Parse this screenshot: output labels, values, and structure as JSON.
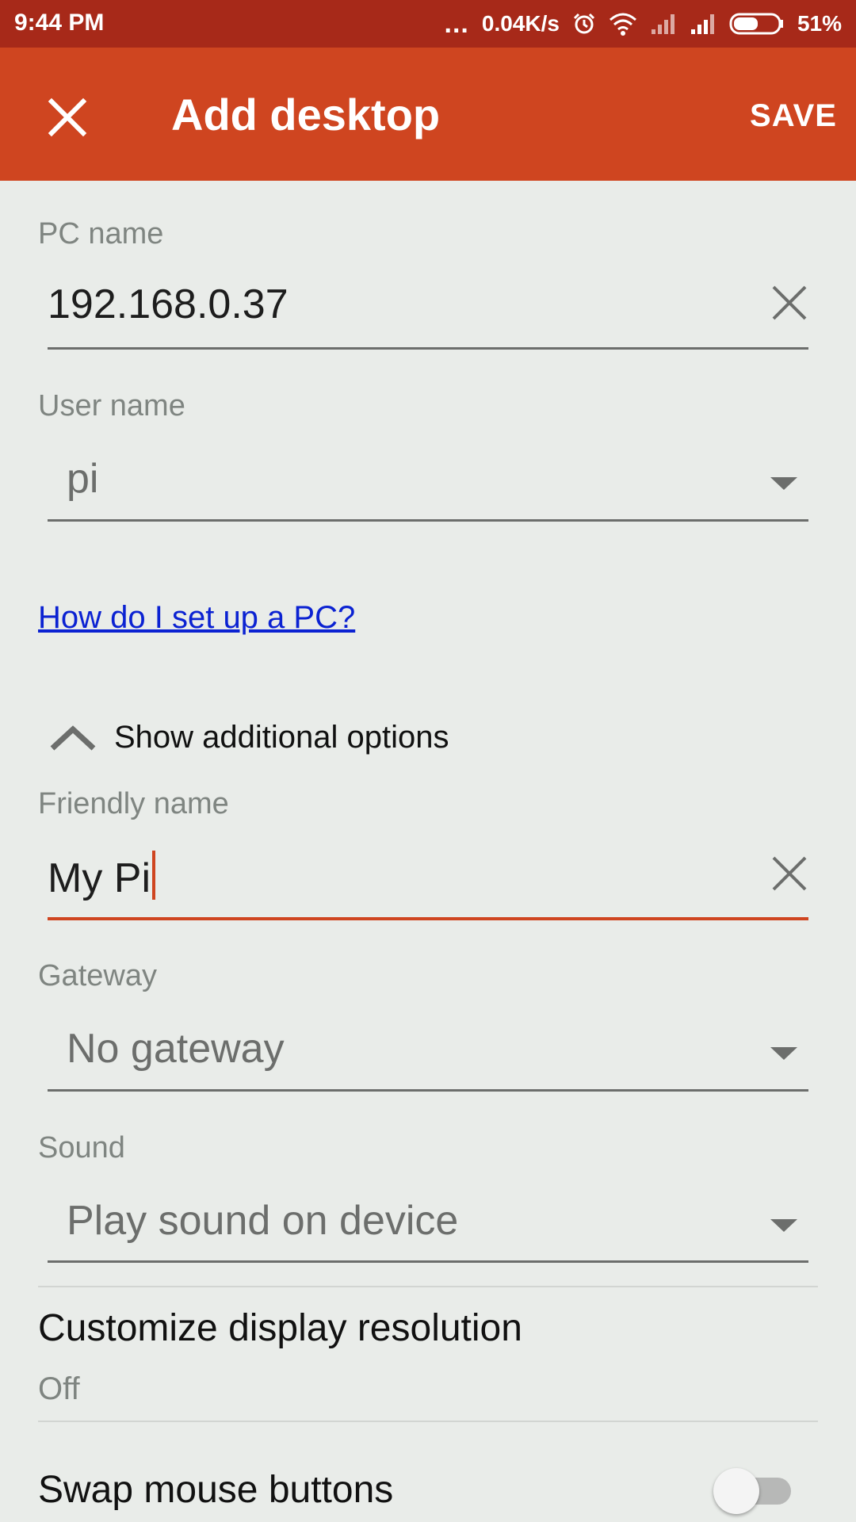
{
  "status_bar": {
    "time": "9:44 PM",
    "dots": "...",
    "network_speed": "0.04K/s",
    "battery": "51%",
    "icons": [
      "alarm-icon",
      "wifi-icon",
      "signal-icon",
      "signal-icon",
      "battery-icon"
    ]
  },
  "app_bar": {
    "title": "Add desktop",
    "save_label": "SAVE",
    "close_icon": "close-icon"
  },
  "form": {
    "pc_name": {
      "label": "PC name",
      "value": "192.168.0.37"
    },
    "user_name": {
      "label": "User name",
      "value": "pi"
    },
    "help_link": "How do I set up a PC?",
    "additional_options": {
      "label": "Show additional options",
      "expanded": true
    },
    "friendly_name": {
      "label": "Friendly name",
      "value": "My Pi"
    },
    "gateway": {
      "label": "Gateway",
      "value": "No gateway"
    },
    "sound": {
      "label": "Sound",
      "value": "Play sound on device"
    },
    "display_resolution": {
      "title": "Customize display resolution",
      "value": "Off"
    },
    "swap_mouse": {
      "title": "Swap mouse buttons",
      "enabled": false
    }
  },
  "colors": {
    "status_bar": "#a72919",
    "app_bar": "#cf4520",
    "accent": "#cf4520",
    "background": "#e9ece9",
    "link": "#0b22d2"
  }
}
